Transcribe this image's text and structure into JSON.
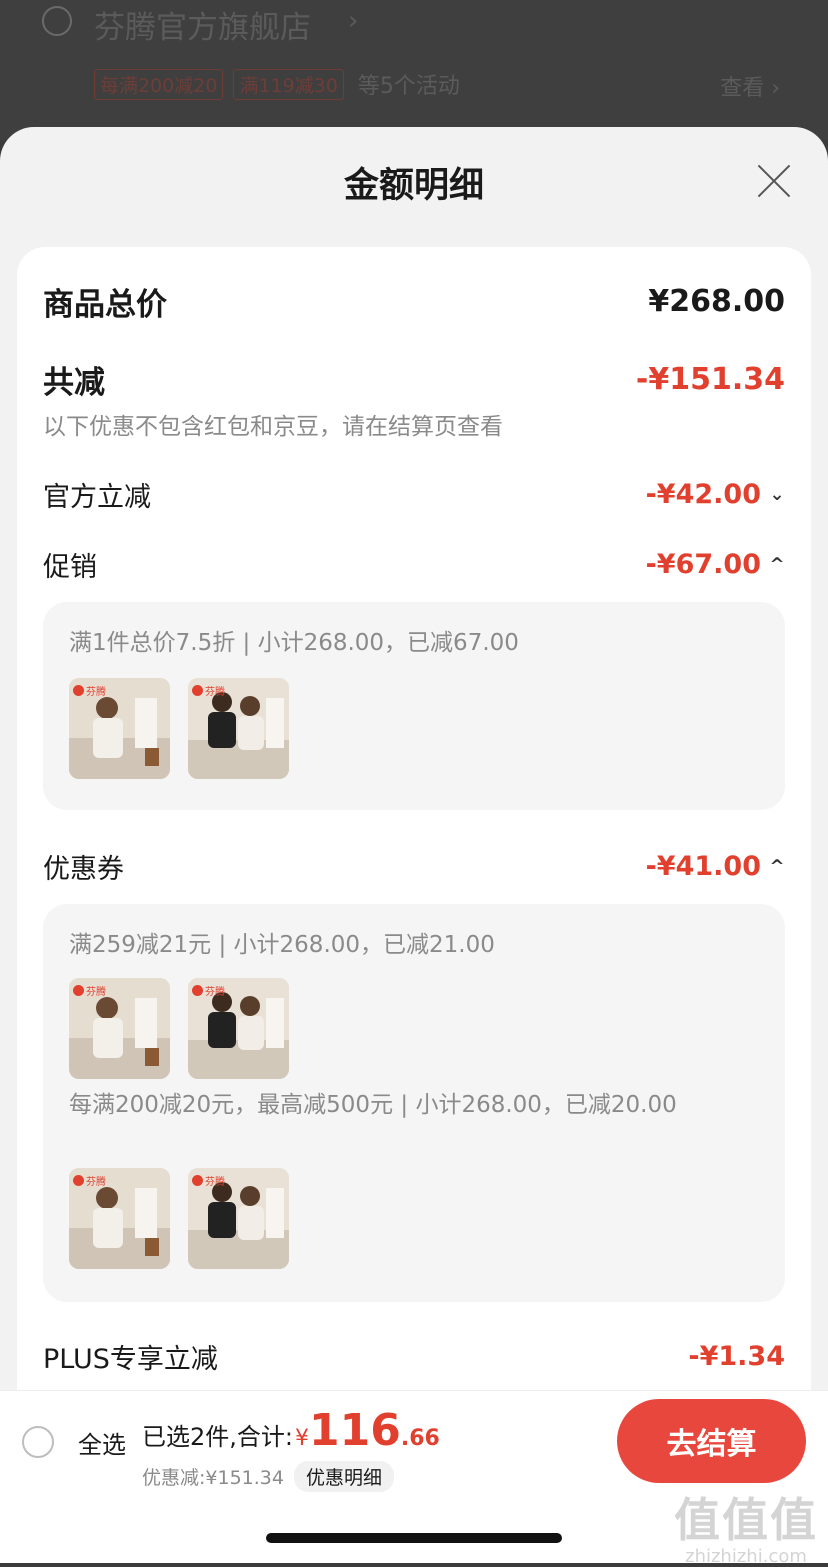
{
  "store": {
    "name": "芬腾官方旗舰店",
    "tags": [
      "每满200减20",
      "满119减30"
    ],
    "tags_suffix": "等5个活动",
    "view_label": "查看 ›"
  },
  "sheet": {
    "title": "金额明细",
    "total_label": "商品总价",
    "total_value": "¥268.00",
    "reduce_label": "共减",
    "reduce_value": "-¥151.34",
    "note": "以下优惠不包含红包和京豆，请在结算页查看",
    "official_label": "官方立减",
    "official_value": "-¥42.00",
    "promo_label": "促销",
    "promo_value": "-¥67.00",
    "promo_detail": "满1件总价7.5折 | 小计268.00，已减67.00",
    "coupon_label": "优惠券",
    "coupon_value": "-¥41.00",
    "coupon_detail_1": "满259减21元 | 小计268.00，已减21.00",
    "coupon_detail_2": "每满200减20元，最高减500元 | 小计268.00，已减20.00",
    "plus_label": "PLUS专享立减",
    "plus_value": "-¥1.34",
    "thumb_badge": "芬腾"
  },
  "bottom": {
    "select_all": "全选",
    "sum_prefix": "已选2件,合计:",
    "currency": "¥",
    "sum_int": "116",
    "sum_dec": ".66",
    "discount_text": "优惠减:¥151.34",
    "discount_detail": "优惠明细",
    "checkout": "去结算"
  },
  "watermark": {
    "logo": "值值值",
    "url": "zhizhizhi.com"
  },
  "colors": {
    "accent": "#e1402f",
    "button": "#e8473e"
  }
}
